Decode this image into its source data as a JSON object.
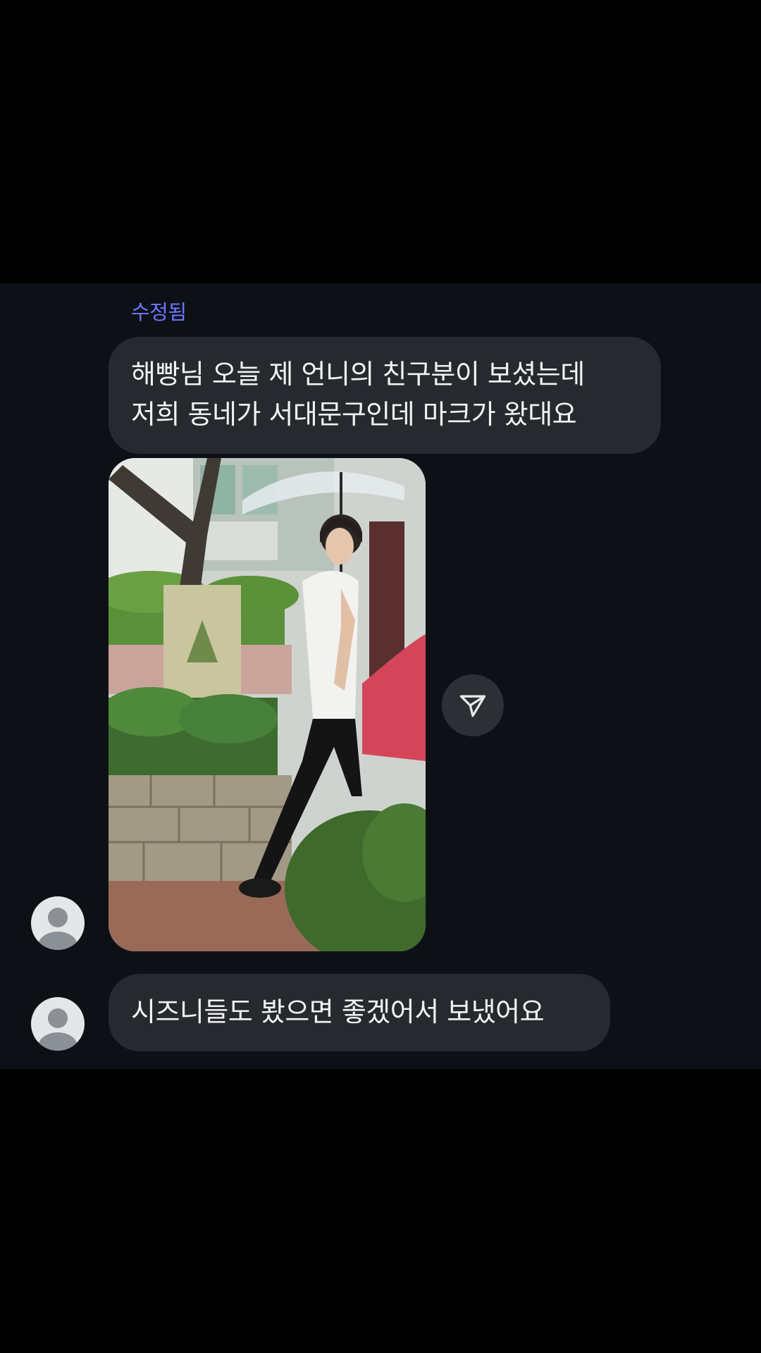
{
  "conversation": {
    "edited_label": "수정됨",
    "message_1": {
      "lines": [
        "해빵님 오늘 제 언니의 친구분이 보셨는데",
        "저희 동네가 서대문구인데 마크가 왔대요"
      ]
    },
    "photo": {
      "description_icon": "photo-attachment"
    },
    "share": {
      "icon": "send-icon"
    },
    "message_2": {
      "text": "시즈니들도 봤으면 좋겠어서 보냈어요"
    }
  },
  "colors": {
    "background": "#000000",
    "chat_background": "#0d1116",
    "bubble": "#262a2f",
    "text": "#f2f2f2",
    "edited_label": "#6b74ff",
    "share_button": "#2c3035"
  }
}
